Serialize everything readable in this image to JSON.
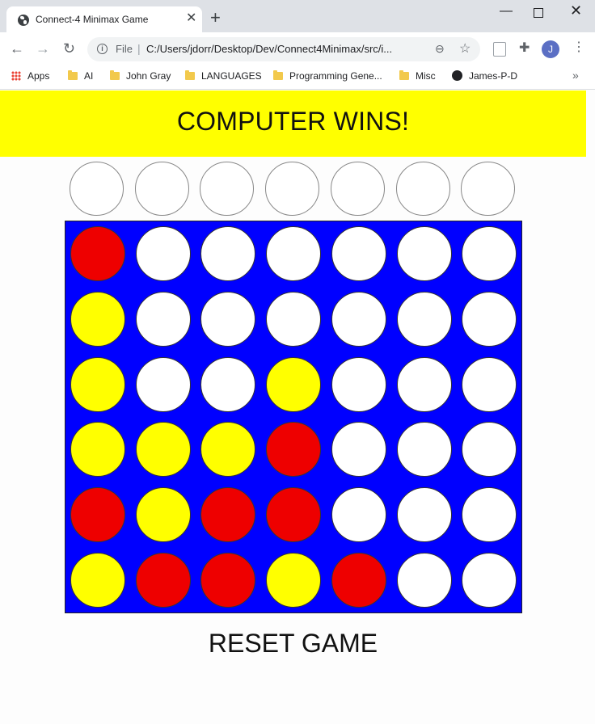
{
  "browser": {
    "tab_title": "Connect-4 Minimax Game",
    "tab_close": "✕",
    "new_tab": "+",
    "win_min": "—",
    "win_close": "✕",
    "omnibox_scheme": "File",
    "omnibox_url": "C:/Users/jdorr/Desktop/Dev/Connect4Minimax/src/i...",
    "avatar_initial": "J",
    "bookmarks": [
      "Apps",
      "AI",
      "John Gray",
      "LANGUAGES",
      "Programming Gene...",
      "Misc",
      "James-P-D"
    ],
    "bookmarks_more": "»"
  },
  "game": {
    "status": "COMPUTER WINS!",
    "reset_label": "RESET GAME",
    "columns": 7,
    "board": [
      [
        "red",
        "white",
        "white",
        "white",
        "white",
        "white",
        "white"
      ],
      [
        "yellow",
        "white",
        "white",
        "white",
        "white",
        "white",
        "white"
      ],
      [
        "yellow",
        "white",
        "white",
        "yellow",
        "white",
        "white",
        "white"
      ],
      [
        "yellow",
        "yellow",
        "yellow",
        "red",
        "white",
        "white",
        "white"
      ],
      [
        "red",
        "yellow",
        "red",
        "red",
        "white",
        "white",
        "white"
      ],
      [
        "yellow",
        "red",
        "red",
        "yellow",
        "red",
        "white",
        "white"
      ]
    ]
  },
  "colors": {
    "red": "#ee0000",
    "yellow": "#ffff00",
    "white": "#ffffff",
    "board": "#0000ff",
    "banner": "#ffff00"
  }
}
